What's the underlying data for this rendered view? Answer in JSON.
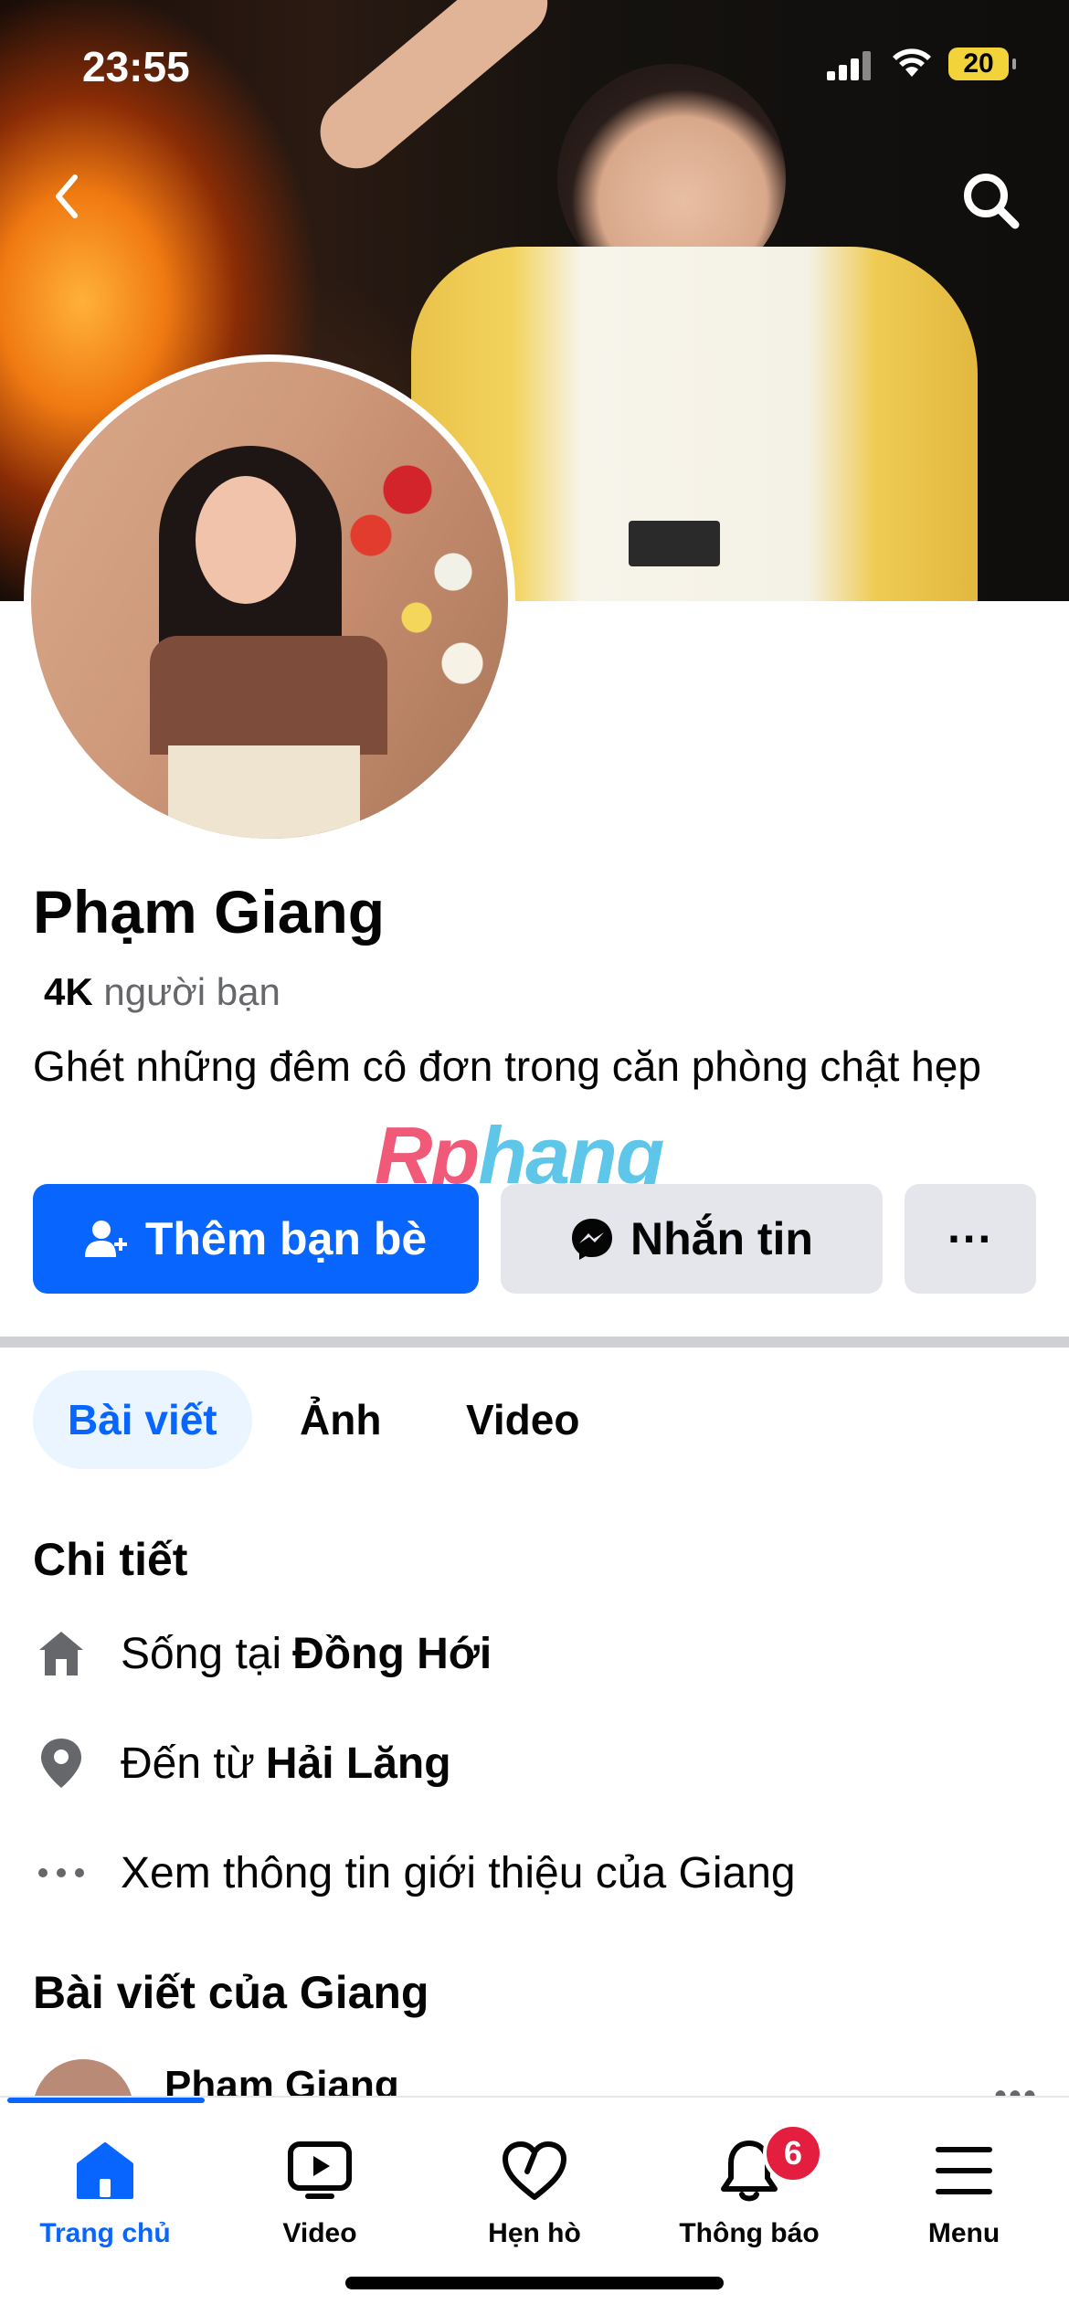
{
  "status_bar": {
    "time": "23:55",
    "battery": "20"
  },
  "profile": {
    "name": "Phạm Giang",
    "friends_count": "4K",
    "friends_label": "người bạn",
    "bio": "Ghét những đêm cô đơn trong căn phòng chật hẹp"
  },
  "watermark": {
    "part1": "Rp",
    "part2": "hang"
  },
  "actions": {
    "add_friend": "Thêm bạn bè",
    "message": "Nhắn tin",
    "more": "···"
  },
  "tabs": [
    {
      "label": "Bài viết",
      "active": true
    },
    {
      "label": "Ảnh",
      "active": false
    },
    {
      "label": "Video",
      "active": false
    }
  ],
  "details": {
    "title": "Chi tiết",
    "lives_in_prefix": "Sống tại",
    "lives_in_value": "Đồng Hới",
    "from_prefix": "Đến từ",
    "from_value": "Hải Lăng",
    "see_about": "Xem thông tin giới thiệu của Giang"
  },
  "posts": {
    "title": "Bài viết của Giang",
    "first_author": "Phạm Giang"
  },
  "bottom_nav": [
    {
      "label": "Trang chủ",
      "icon": "home-icon",
      "active": true
    },
    {
      "label": "Video",
      "icon": "video-icon",
      "active": false
    },
    {
      "label": "Hẹn hò",
      "icon": "heart-icon",
      "active": false
    },
    {
      "label": "Thông báo",
      "icon": "bell-icon",
      "active": false,
      "badge": "6"
    },
    {
      "label": "Menu",
      "icon": "menu-icon",
      "active": false
    }
  ],
  "colors": {
    "accent": "#0866ff",
    "badge": "#e41e3f",
    "secondary_button": "#e4e6eb"
  }
}
